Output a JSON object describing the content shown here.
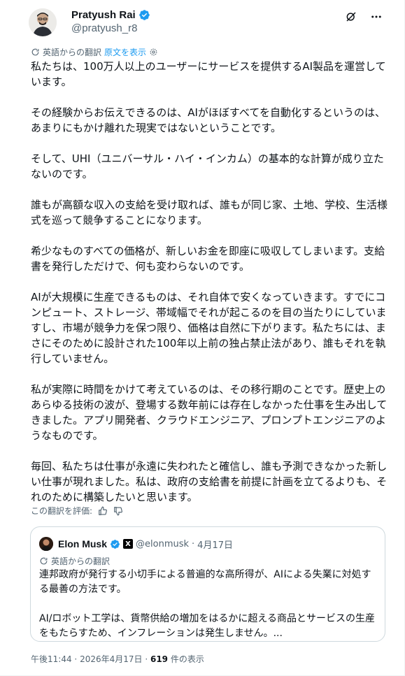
{
  "author": {
    "display_name": "Pratyush Rai",
    "handle": "@pratyush_r8",
    "verified_color": "#1d9bf0"
  },
  "header_actions": [
    "grok-icon",
    "more-icon"
  ],
  "translation": {
    "label": "英語からの翻訳",
    "show_original": "原文を表示"
  },
  "tweet_paragraphs": [
    "私たちは、100万人以上のユーザーにサービスを提供するAI製品を運営しています。",
    "その経験からお伝えできるのは、AIがほぼすべてを自動化するというのは、あまりにもかけ離れた現実ではないということです。",
    "そして、UHI（ユニバーサル・ハイ・インカム）の基本的な計算が成り立たないのです。",
    "誰もが高額な収入の支給を受け取れば、誰もが同じ家、土地、学校、生活様式を巡って競争することになります。",
    "希少なものすべての価格が、新しいお金を即座に吸収してしまいます。支給書を発行しただけで、何も変わらないのです。",
    "AIが大規模に生産できるものは、それ自体で安くなっていきます。すでにコンピュート、ストレージ、帯域幅でそれが起こるのを目の当たりにしていますし、市場が競争力を保つ限り、価格は自然に下がります。私たちには、まさにそのために設計された100年以上前の独占禁止法があり、誰もそれを執行していません。",
    "私が実際に時間をかけて考えているのは、その移行期のことです。歴史上のあらゆる技術の波が、登場する数年前には存在しなかった仕事を生み出してきました。アプリ開発者、クラウドエンジニア、プロンプトエンジニアのようなものです。",
    "毎回、私たちは仕事が永遠に失われたと確信し、誰も予測できなかった新しい仕事が現れました。私は、政府の支給書を前提に計画を立てるよりも、それのために構築したいと思います。"
  ],
  "rate_translation": "この翻訳を評価:",
  "quote": {
    "display_name": "Elon Musk",
    "x_badge": "X",
    "handle": "@elonmusk",
    "date": "4月17日",
    "translation_label": "英語からの翻訳",
    "paragraphs": [
      "連邦政府が発行する小切手による普遍的な高所得が、AIによる失業に対処する最善の方法です。",
      "AI/ロボット工学は、貨幣供給の増加をはるかに超える商品とサービスの生産をもたらすため、インフレーションは発生しません。..."
    ]
  },
  "meta": {
    "time": "午後11:44",
    "date": "2026年4月17日",
    "views_count": "619",
    "views_label": "件の表示"
  }
}
